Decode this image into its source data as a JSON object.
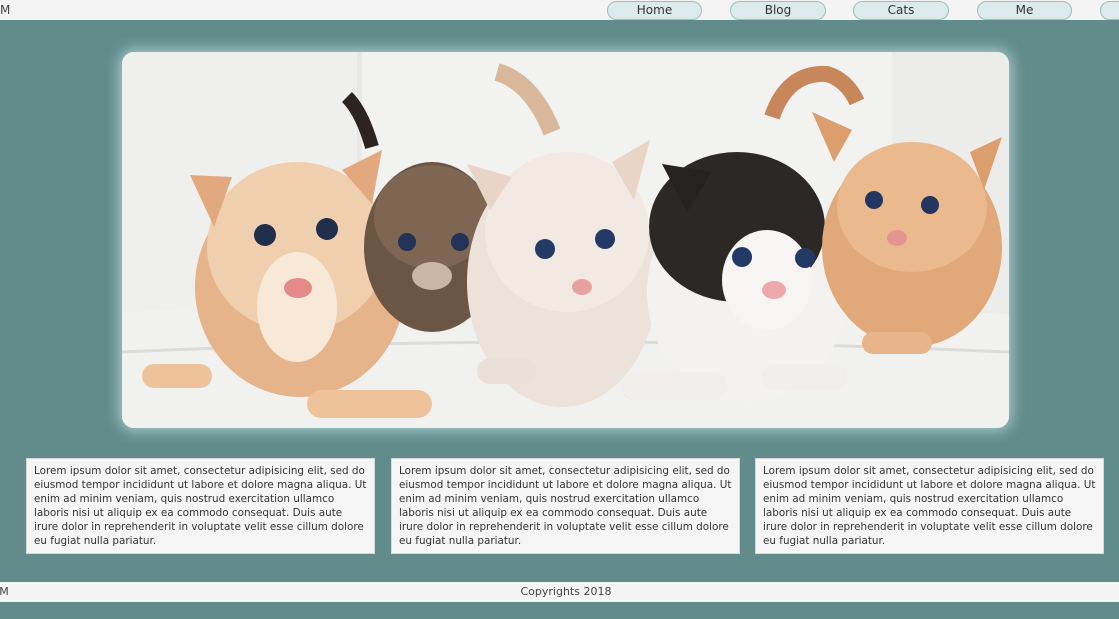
{
  "header": {
    "brand": "JM",
    "nav": [
      {
        "label": "Home"
      },
      {
        "label": "Blog"
      },
      {
        "label": "Cats"
      },
      {
        "label": "Me"
      }
    ]
  },
  "hero": {
    "image": "kittens-photo"
  },
  "cards": [
    {
      "text": "Lorem ipsum dolor sit amet, consectetur adipisicing elit, sed do eiusmod tempor incididunt ut labore et dolore magna aliqua. Ut enim ad minim veniam, quis nostrud exercitation ullamco laboris nisi ut aliquip ex ea commodo consequat. Duis aute irure dolor in reprehenderit in voluptate velit esse cillum dolore eu fugiat nulla pariatur."
    },
    {
      "text": "Lorem ipsum dolor sit amet, consectetur adipisicing elit, sed do eiusmod tempor incididunt ut labore et dolore magna aliqua. Ut enim ad minim veniam, quis nostrud exercitation ullamco laboris nisi ut aliquip ex ea commodo consequat. Duis aute irure dolor in reprehenderit in voluptate velit esse cillum dolore eu fugiat nulla pariatur."
    },
    {
      "text": "Lorem ipsum dolor sit amet, consectetur adipisicing elit, sed do eiusmod tempor incididunt ut labore et dolore magna aliqua. Ut enim ad minim veniam, quis nostrud exercitation ullamco laboris nisi ut aliquip ex ea commodo consequat. Duis aute irure dolor in reprehenderit in voluptate velit esse cillum dolore eu fugiat nulla pariatur."
    }
  ],
  "footer": {
    "brand": "JM",
    "copyright": "Copyrights 2018"
  },
  "colors": {
    "page_background": "#628b8c",
    "bar_background": "#f4f4f4",
    "nav_button": "#dbeaea"
  }
}
